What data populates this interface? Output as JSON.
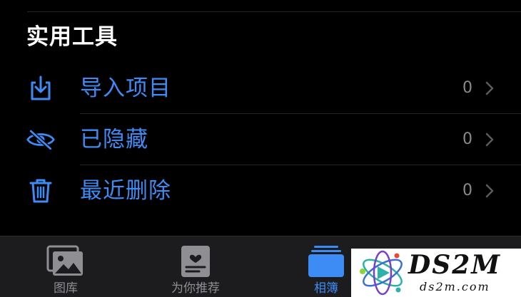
{
  "section": {
    "title": "实用工具"
  },
  "rows": [
    {
      "label": "导入项目",
      "count": "0",
      "icon": "import-icon"
    },
    {
      "label": "已隐藏",
      "count": "0",
      "icon": "eye-slash-icon"
    },
    {
      "label": "最近删除",
      "count": "0",
      "icon": "trash-icon"
    }
  ],
  "tabbar": {
    "tabs": [
      {
        "label": "图库",
        "icon": "photo-library-icon",
        "active": false
      },
      {
        "label": "为你推荐",
        "icon": "for-you-icon",
        "active": false
      },
      {
        "label": "相簿",
        "icon": "albums-icon",
        "active": true
      },
      {
        "label": "",
        "icon": "search-icon",
        "active": false
      }
    ]
  },
  "watermark": {
    "text": "DS2M",
    "subtext": "ds2m.com"
  },
  "colors": {
    "accent": "#3d8bf4",
    "background": "#000000",
    "tabbar": "#1c1c1e",
    "secondary_text": "#8a8a8e"
  }
}
